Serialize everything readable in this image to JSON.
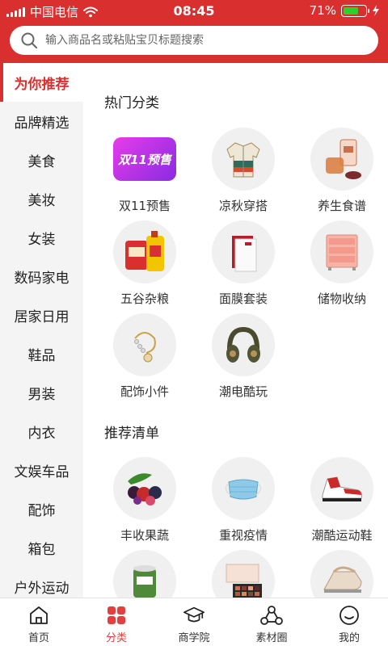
{
  "status_bar": {
    "carrier": "中国电信",
    "time": "08:45",
    "battery": "71%",
    "battery_level": 0.71
  },
  "search": {
    "placeholder": "输入商品名或粘贴宝贝标题搜索"
  },
  "sidebar": {
    "items": [
      {
        "label": "为你推荐",
        "active": true
      },
      {
        "label": "品牌精选"
      },
      {
        "label": "美食"
      },
      {
        "label": "美妆"
      },
      {
        "label": "女装"
      },
      {
        "label": "数码家电"
      },
      {
        "label": "居家日用"
      },
      {
        "label": "鞋品"
      },
      {
        "label": "男装"
      },
      {
        "label": "内衣"
      },
      {
        "label": "文娱车品"
      },
      {
        "label": "配饰"
      },
      {
        "label": "箱包"
      },
      {
        "label": "户外运动"
      }
    ]
  },
  "hot": {
    "title": "热门分类",
    "items": [
      {
        "label": "双11预售",
        "icon": "double11-presale-icon",
        "badge_text": "双11预售"
      },
      {
        "label": "凉秋穿搭",
        "icon": "jacket-icon"
      },
      {
        "label": "养生食谱",
        "icon": "tea-jar-icon"
      },
      {
        "label": "五谷杂粮",
        "icon": "rice-oil-icon"
      },
      {
        "label": "面膜套装",
        "icon": "face-mask-box-icon"
      },
      {
        "label": "储物收纳",
        "icon": "storage-drawer-icon"
      },
      {
        "label": "配饰小件",
        "icon": "bracelet-icon"
      },
      {
        "label": "潮电酷玩",
        "icon": "headphones-icon"
      }
    ]
  },
  "recommend": {
    "title": "推荐清单",
    "items": [
      {
        "label": "丰收果蔬",
        "icon": "fruit-icon"
      },
      {
        "label": "重视疫情",
        "icon": "medical-mask-icon"
      },
      {
        "label": "潮酷运动鞋",
        "icon": "sneaker-icon"
      },
      {
        "label": "",
        "icon": "snack-cup-icon"
      },
      {
        "label": "",
        "icon": "eyeshadow-palette-icon"
      },
      {
        "label": "",
        "icon": "iron-icon"
      }
    ]
  },
  "tabbar": {
    "items": [
      {
        "label": "首页",
        "icon": "home-icon"
      },
      {
        "label": "分类",
        "icon": "category-icon",
        "active": true
      },
      {
        "label": "商学院",
        "icon": "graduation-cap-icon"
      },
      {
        "label": "素材圈",
        "icon": "share-circle-icon"
      },
      {
        "label": "我的",
        "icon": "profile-icon"
      }
    ]
  },
  "colors": {
    "brand_red": "#d9302f",
    "tab_active": "#e2403e",
    "sidebar_bg": "#f4f4f4"
  }
}
